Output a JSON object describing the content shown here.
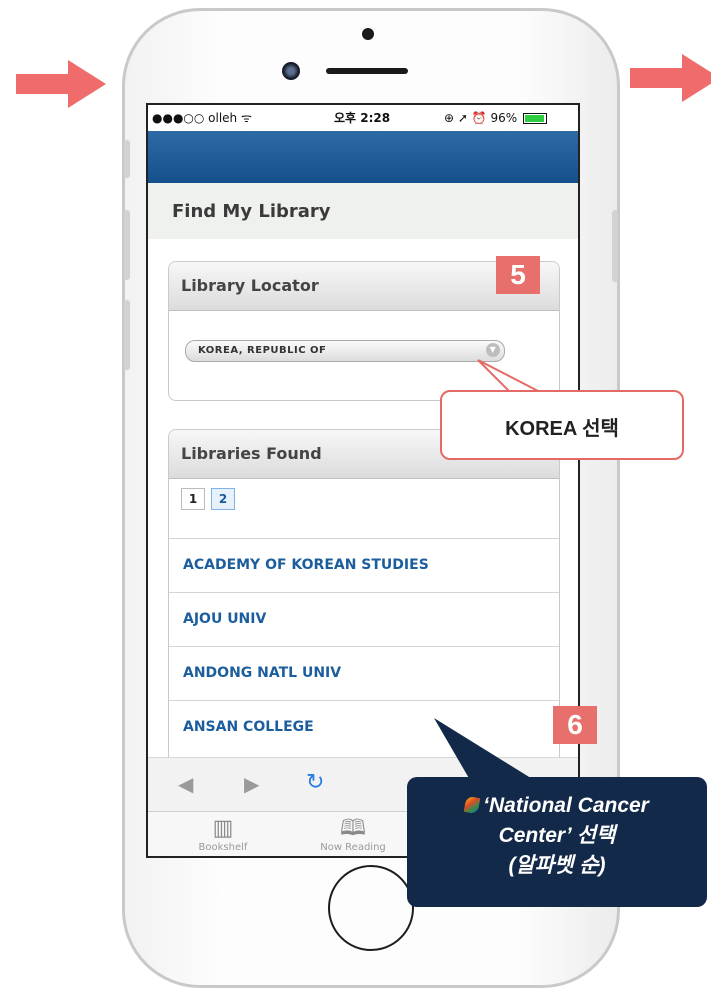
{
  "status_bar": {
    "carrier": "●●●○○ olleh ᯤ",
    "time": "오후 2:28",
    "right": "⊕ ➚ ⏰ 96%"
  },
  "page": {
    "title": "Find My Library"
  },
  "library_locator": {
    "title": "Library Locator",
    "country_select_value": "KOREA, REPUBLIC OF"
  },
  "libraries_found": {
    "title": "Libraries Found",
    "pages": [
      "1",
      "2"
    ],
    "active_page": "2",
    "items": [
      "ACADEMY OF KOREAN STUDIES",
      "AJOU UNIV",
      "ANDONG NATL UNIV",
      "ANSAN COLLEGE"
    ]
  },
  "toolbar": {
    "back_icon": "back-arrow-icon",
    "forward_icon": "forward-arrow-icon",
    "reload_icon": "reload-icon"
  },
  "tabs": [
    {
      "label": "Bookshelf",
      "icon": "bookshelf-icon"
    },
    {
      "label": "Now Reading",
      "icon": "open-book-icon"
    }
  ],
  "annotations": {
    "step5": "5",
    "step6": "6",
    "callout_korea": "KOREA 선택",
    "callout_cancer_line1": "‘National Cancer",
    "callout_cancer_line2": "Center’ 선택",
    "callout_cancer_line3": "(알파벳 순)"
  },
  "colors": {
    "accent_red": "#e7706d",
    "nav_blue": "#14508c",
    "link_blue": "#1c5e9d",
    "callout_navy": "#13294a"
  }
}
